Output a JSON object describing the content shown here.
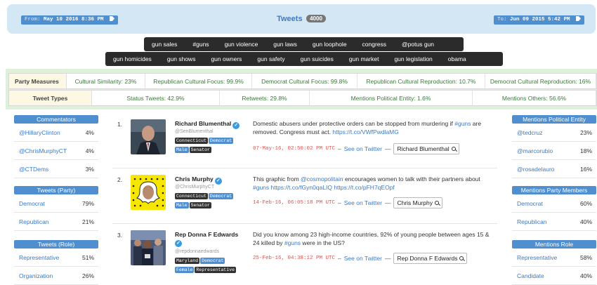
{
  "header": {
    "from_label": "From:",
    "from_value": "May 10 2016 8:36 PM",
    "title": "Tweets",
    "count": "4000",
    "to_label": "To:",
    "to_value": "Jun 09 2015 5:42 PM"
  },
  "tags_row1": [
    "gun sales",
    "#guns",
    "gun violence",
    "gun laws",
    "gun loophole",
    "congress",
    "@potus gun"
  ],
  "tags_row2": [
    "gun homicides",
    "gun shows",
    "gun owners",
    "gun safety",
    "gun suicides",
    "gun market",
    "gun legislation",
    "obama"
  ],
  "measures": {
    "party_label": "Party Measures",
    "party_cells": [
      "Cultural Similarity: 23%",
      "Republican Cultural Focus: 99.9%",
      "Democrat Cultural Focus: 99.8%",
      "Republican Cultural Reproduction: 10.7%",
      "Democrat Cultural Reproduction: 16%"
    ],
    "types_label": "Tweet Types",
    "types_cells": [
      "Status Tweets: 42.9%",
      "Retweets: 29.8%",
      "Mentions Political Entity: 1.6%",
      "Mentions Others: 56.6%"
    ]
  },
  "left": {
    "commentators": {
      "title": "Commentators",
      "rows": [
        {
          "k": "@HillaryClinton",
          "v": "4%"
        },
        {
          "k": "@ChrisMurphyCT",
          "v": "4%"
        },
        {
          "k": "@CTDems",
          "v": "3%"
        }
      ]
    },
    "party": {
      "title": "Tweets (Party)",
      "rows": [
        {
          "k": "Democrat",
          "v": "79%"
        },
        {
          "k": "Republican",
          "v": "21%"
        }
      ]
    },
    "role": {
      "title": "Tweets (Role)",
      "rows": [
        {
          "k": "Representative",
          "v": "51%"
        },
        {
          "k": "Organization",
          "v": "26%"
        }
      ]
    }
  },
  "right": {
    "political": {
      "title": "Mentions Political Entity",
      "rows": [
        {
          "k": "@tedcruz",
          "v": "23%"
        },
        {
          "k": "@marcorubio",
          "v": "18%"
        },
        {
          "k": "@rosadelauro",
          "v": "16%"
        }
      ]
    },
    "party_members": {
      "title": "Mentions Party Members",
      "rows": [
        {
          "k": "Democrat",
          "v": "60%"
        },
        {
          "k": "Republican",
          "v": "40%"
        }
      ]
    },
    "role": {
      "title": "Mentions Role",
      "rows": [
        {
          "k": "Representative",
          "v": "58%"
        },
        {
          "k": "Candidate",
          "v": "40%"
        }
      ]
    }
  },
  "tweets": [
    {
      "num": "1.",
      "name": "Richard Blumenthal",
      "handle": "@SenBlumenthal",
      "badges": [
        "Connecticut",
        "Democrat",
        "Male",
        "Senator"
      ],
      "text_a": "Domestic abusers under protective orders can be stopped from murdering if ",
      "text_hashtag": "#guns",
      "text_b": " are removed. Congress must act. ",
      "text_link": "https://t.co/VWfPwdlaMG",
      "date": "07-May-16, 02:50:02 PM UTC",
      "see_on": "See on Twitter",
      "search_label": "Richard Blumenthal"
    },
    {
      "num": "2.",
      "name": "Chris Murphy",
      "handle": "@ChrisMurphyCT",
      "badges": [
        "Connecticut",
        "Democrat",
        "Male",
        "Senator"
      ],
      "text_a": "This graphic from ",
      "text_mention": "@cosmopolitain",
      "text_b": " encourages women to talk with their partners about ",
      "text_hashtag": "#guns",
      "text_link": "https://t.co/fGyn0qaLIQ https://t.co/pFH7qEOpf",
      "date": "14-Feb-16, 06:05:18 PM UTC",
      "see_on": "See on Twitter",
      "search_label": "Chris Murphy"
    },
    {
      "num": "3.",
      "name": "Rep Donna F Edwards",
      "handle": "@repdonnaedwards",
      "badges": [
        "Maryland",
        "Democrat",
        "Female",
        "Representative"
      ],
      "text_a": "Did you know among 23 high-income countries, 92% of young people between ages 15 & 24 killed by ",
      "text_hashtag": "#guns",
      "text_b": " were in the US?",
      "date": "25-Feb-16, 04:38:12 PM UTC",
      "see_on": "See on Twitter",
      "search_label": "Rep Donna F Edwards"
    }
  ],
  "colors": {
    "header_bg": "#d3e7f4",
    "accent_blue": "#4f8fd0",
    "tag_bar": "#2b2b2b",
    "measures_band": "#dff0d8",
    "measure_text": "#3c7a3c",
    "date_red": "#d9534f"
  }
}
